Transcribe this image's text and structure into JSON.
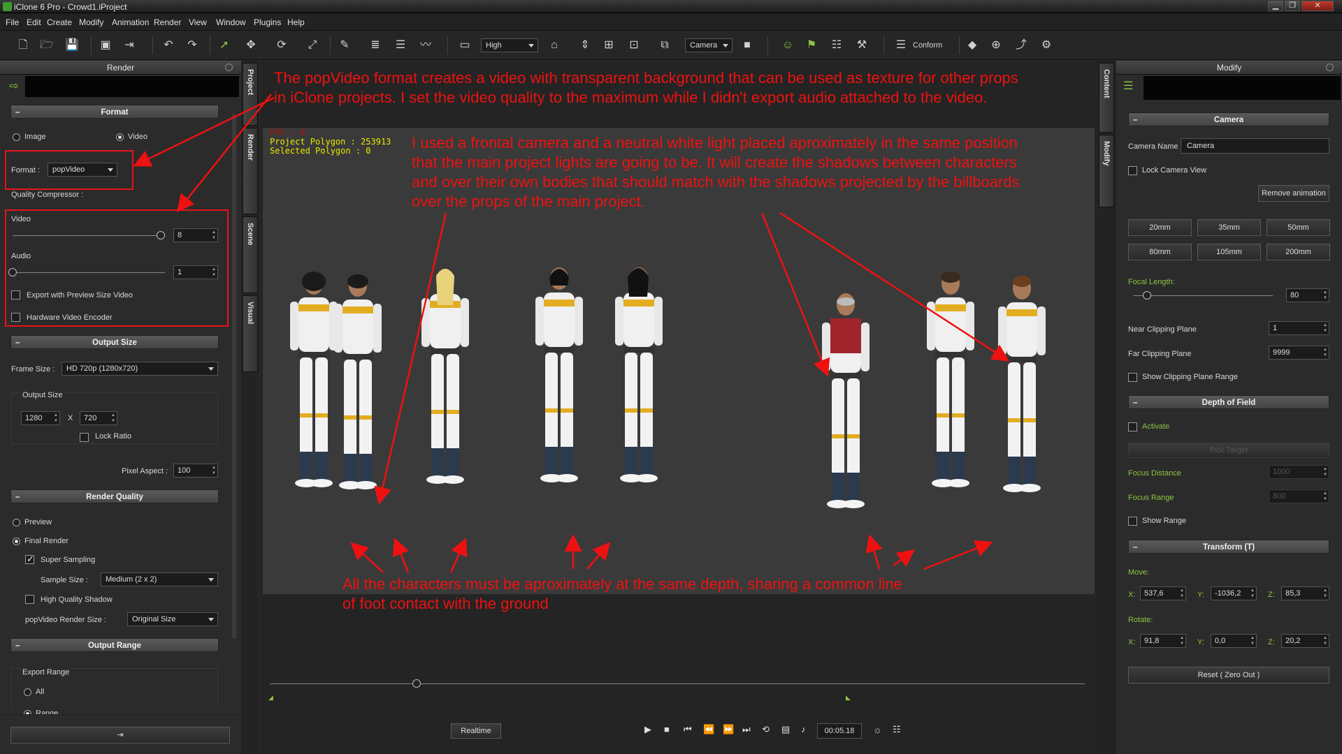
{
  "window": {
    "title": "iClone 6 Pro - Crowd1.iProject",
    "min": "▁",
    "max": "❐",
    "close": "✕"
  },
  "menu": [
    "File",
    "Edit",
    "Create",
    "Modify",
    "Animation",
    "Render",
    "View",
    "Window",
    "Plugins",
    "Help"
  ],
  "toolbar": {
    "quality": "High",
    "camera": "Camera",
    "conform": "Conform"
  },
  "render_panel": {
    "title": "Render",
    "format_section": "Format",
    "image_label": "Image",
    "video_label": "Video",
    "format_label": "Format :",
    "format_value": "popVideo",
    "quality_compressor": "Quality Compressor :",
    "video_quality_label": "Video",
    "video_quality_value": "8",
    "video_quality_fraction": 1.0,
    "audio_label": "Audio",
    "audio_value": "1",
    "audio_fraction": 0.0,
    "export_preview": "Export with Preview Size Video",
    "hardware_encoder": "Hardware Video Encoder",
    "output_size_section": "Output Size",
    "frame_size_label": "Frame Size :",
    "frame_size_value": "HD 720p (1280x720)",
    "output_size_group": "Output Size",
    "width": "1280",
    "x_label": "X",
    "height": "720",
    "lock_ratio": "Lock Ratio",
    "pixel_aspect_label": "Pixel Aspect :",
    "pixel_aspect_value": "100",
    "render_quality_section": "Render Quality",
    "preview": "Preview",
    "final_render": "Final Render",
    "super_sampling": "Super Sampling",
    "sample_size_label": "Sample Size :",
    "sample_size_value": "Medium (2 x 2)",
    "hq_shadow": "High Quality Shadow",
    "popvideo_size_label": "popVideo Render Size :",
    "popvideo_size_value": "Original Size",
    "output_range_section": "Output Range",
    "export_range": "Export Range",
    "all": "All",
    "range": "Range"
  },
  "left_tabs": [
    "Project",
    "Render",
    "Scene",
    "Visual"
  ],
  "right_tabs": [
    "Content",
    "Modify"
  ],
  "viewport": {
    "fps": "FPS : 0",
    "project_polygon": "Project Polygon : 253913",
    "selected_polygon": "Selected Polygon : 0",
    "realtime": "Realtime",
    "timecode": "00:05.18",
    "timeline_fraction": 0.18
  },
  "annotations": {
    "top": [
      "The popVideo format creates a video with transparent background that can be used as texture for other props",
      "in iClone projects. I set the video quality to the maximum while I didn't export audio attached to the video."
    ],
    "middle": [
      "I used a frontal camera and a neutral white light placed aproximately in the same position",
      "that the main project lights are going to be. It will create the shadows between characters",
      "and over their own bodies that should match with the shadows projected by the billboards",
      "over the props of the main project."
    ],
    "bottom": [
      "All the characters must be aproximately at the same depth, sharing a common line",
      "of foot contact with the ground"
    ]
  },
  "modify_panel": {
    "title": "Modify",
    "camera_section": "Camera",
    "camera_name_label": "Camera Name :",
    "camera_name_value": "Camera",
    "lock_camera_view": "Lock Camera View",
    "remove_animation": "Remove  animation",
    "lens": [
      "20mm",
      "35mm",
      "50mm",
      "80mm",
      "105mm",
      "200mm"
    ],
    "focal_length_label": "Focal Length:",
    "focal_length_value": "80",
    "focal_fraction": 0.1,
    "near_clip_label": "Near Clipping Plane",
    "near_clip_value": "1",
    "far_clip_label": "Far Clipping Plane",
    "far_clip_value": "9999",
    "show_clip_range": "Show Clipping Plane Range",
    "dof_section": "Depth of Field",
    "activate": "Activate",
    "pick_target": "Pick Target",
    "focus_distance_label": "Focus Distance",
    "focus_distance_value": "1000",
    "focus_range_label": "Focus Range",
    "focus_range_value": "800",
    "show_range": "Show Range",
    "transform_section": "Transform  (T)",
    "move_label": "Move:",
    "move": {
      "x": "537,6",
      "y": "-1036,2",
      "z": "85,3"
    },
    "rotate_label": "Rotate:",
    "rotate": {
      "x": "91,8",
      "y": "0,0",
      "z": "20,2"
    },
    "axis": {
      "x": "X:",
      "y": "Y:",
      "z": "Z:"
    },
    "reset": "Reset ( Zero Out )"
  },
  "colors": {
    "accent_green": "#8dc63f",
    "annotation_red": "#ee1111"
  }
}
